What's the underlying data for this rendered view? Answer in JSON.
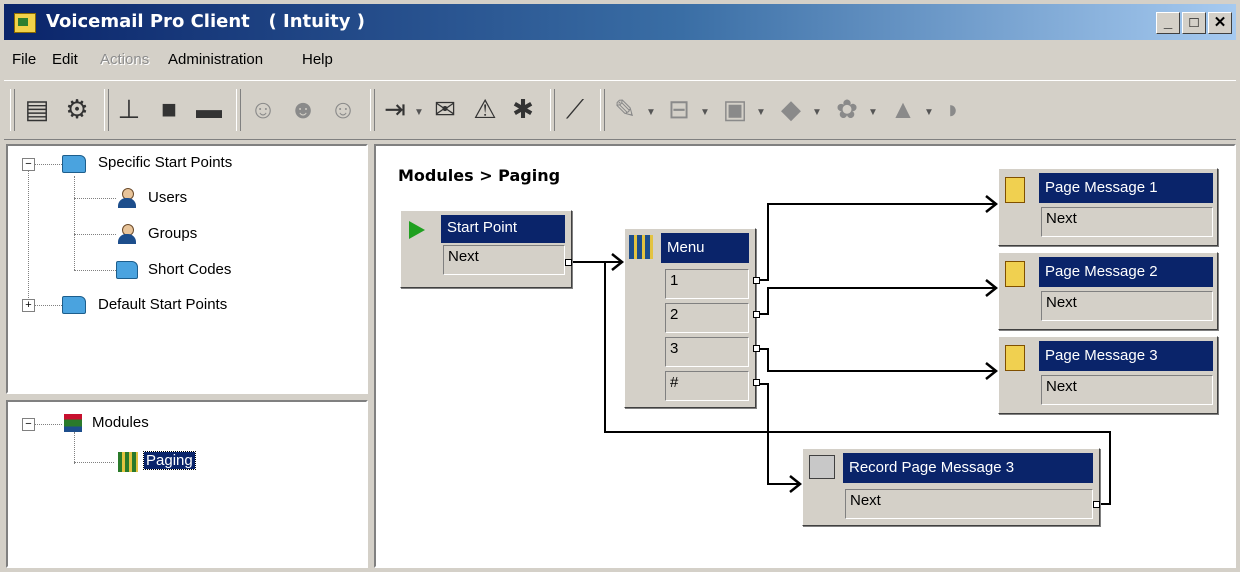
{
  "window": {
    "title": "Voicemail Pro Client   ( Intuity )",
    "minimize_label": "_",
    "maximize_label": "□",
    "close_label": "✕"
  },
  "menubar": [
    {
      "label": "File",
      "enabled": true
    },
    {
      "label": "Edit",
      "enabled": true
    },
    {
      "label": "Actions",
      "enabled": false
    },
    {
      "label": "Administration",
      "enabled": true
    },
    {
      "label": "Help",
      "enabled": true
    }
  ],
  "toolbar": {
    "icons": [
      "save-icon",
      "settings-icon",
      "add-icon",
      "copy-icon",
      "paste-icon",
      "user-icon",
      "user-move-icon",
      "user-delete-icon",
      "general-action-icon",
      "mailbox-action-icon",
      "configuration-icon",
      "telephony-icon",
      "connection-icon",
      "misc-action-icon"
    ]
  },
  "start_points_tree": {
    "root_specific": "Specific Start Points",
    "users": "Users",
    "groups": "Groups",
    "short_codes": "Short Codes",
    "root_default": "Default Start Points",
    "collapse_glyph": "−",
    "expand_glyph": "+"
  },
  "modules_tree": {
    "root": "Modules",
    "paging": "Paging",
    "collapse_glyph": "−"
  },
  "canvas": {
    "breadcrumb": "Modules > Paging",
    "nodes": {
      "start_point": {
        "title": "Start Point",
        "fields": [
          "Next"
        ]
      },
      "menu": {
        "title": "Menu",
        "fields": [
          "1",
          "2",
          "3",
          "#"
        ]
      },
      "page1": {
        "title": "Page Message 1",
        "fields": [
          "Next"
        ]
      },
      "page2": {
        "title": "Page Message 2",
        "fields": [
          "Next"
        ]
      },
      "page3": {
        "title": "Page Message 3",
        "fields": [
          "Next"
        ]
      },
      "record": {
        "title": "Record Page Message 3",
        "fields": [
          "Next"
        ]
      }
    }
  },
  "colors": {
    "selection": "#0a246a",
    "window_face": "#d4d0c8",
    "wire": "#000000"
  }
}
